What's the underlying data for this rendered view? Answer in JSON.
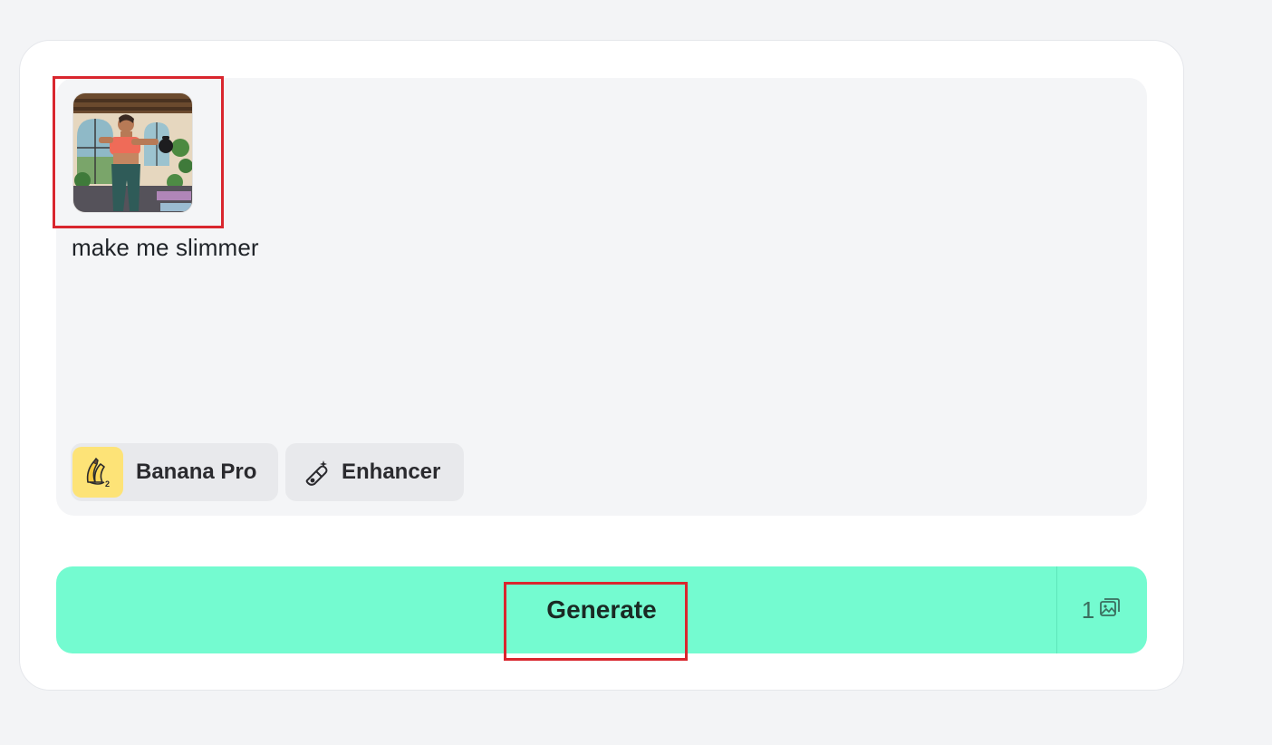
{
  "prompt": {
    "text": "make me slimmer"
  },
  "toolbar": {
    "model_label": "Banana Pro",
    "enhancer_label": "Enhancer"
  },
  "generate": {
    "label": "Generate",
    "count": "1"
  },
  "icons": {
    "model": "banana-icon",
    "enhancer": "magic-wand-icon",
    "count": "image-stack-icon"
  },
  "colors": {
    "generate_bg": "#74fbd0",
    "highlight": "#d9262e",
    "model_tile": "#fde377"
  }
}
